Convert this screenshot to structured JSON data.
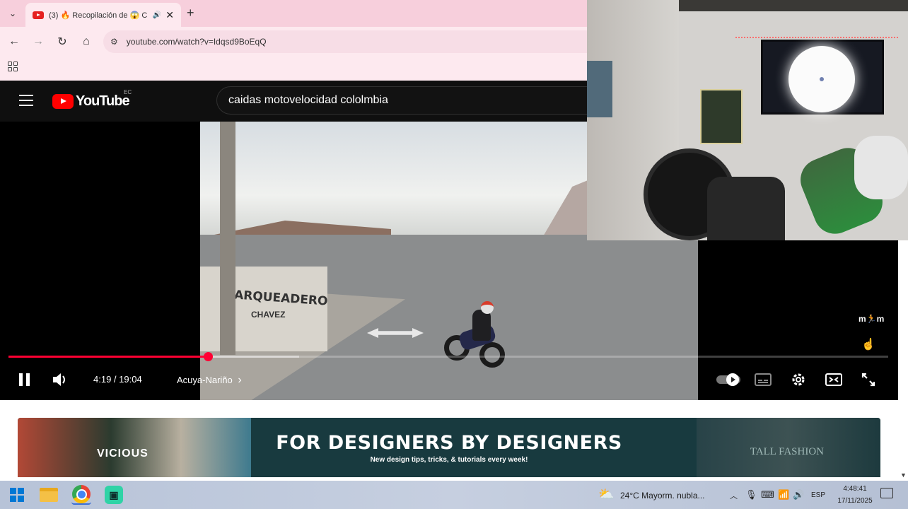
{
  "browser": {
    "tab_title": "(3) 🔥 Recopilación de 😱 C",
    "tab_audio_icon": "🔊",
    "tab_close": "✕",
    "new_tab": "+",
    "tab_list": "⌄",
    "url": "youtube.com/watch?v=Idqsd9BoEqQ",
    "nav": {
      "back": "←",
      "forward": "→",
      "reload": "↻",
      "home": "⌂"
    }
  },
  "youtube": {
    "logo_text": "YouTube",
    "country_code": "EC",
    "search_query": "caidas  motovelocidad  cololmbia"
  },
  "video": {
    "wall_text": "ARQUEADERO",
    "wall_text_2": "CHAVEZ"
  },
  "player": {
    "current_time": "4:19",
    "duration": "19:04",
    "time_display": "4:19 / 19:04",
    "chapter": "Acuya-Nariño",
    "chapter_arrow": "›",
    "progress_played_fraction": 0.2265,
    "progress_buffered_fraction": 0.33,
    "autoplay_on": true,
    "channel_watermark": "m🏃m",
    "icons": [
      "pause-icon",
      "volume-icon",
      "autoplay-toggle",
      "subtitles-icon",
      "settings-icon",
      "theater-icon",
      "fullscreen-icon"
    ]
  },
  "ad": {
    "title": "FOR DESIGNERS BY DESIGNERS",
    "subtitle": "New design tips, tricks, & tutorials every week!",
    "art_text_left": "VICIOUS",
    "art_text_right": "TALL FASHION"
  },
  "taskbar": {
    "weather_temp": "24°C",
    "weather_desc": "Mayorm. nubla...",
    "weather_text": "24°C  Mayorm. nubla...",
    "language": "ESP",
    "time": "4:48:41",
    "date": "17/11/2025",
    "apps": [
      "start",
      "file-explorer",
      "chrome",
      "app"
    ]
  },
  "colors": {
    "tab_bar": "#f7cfdc",
    "youtube_red": "#ff0000",
    "progress_red": "#ff0033",
    "player_bg": "#000000",
    "ad_bg": "#183a3f"
  }
}
